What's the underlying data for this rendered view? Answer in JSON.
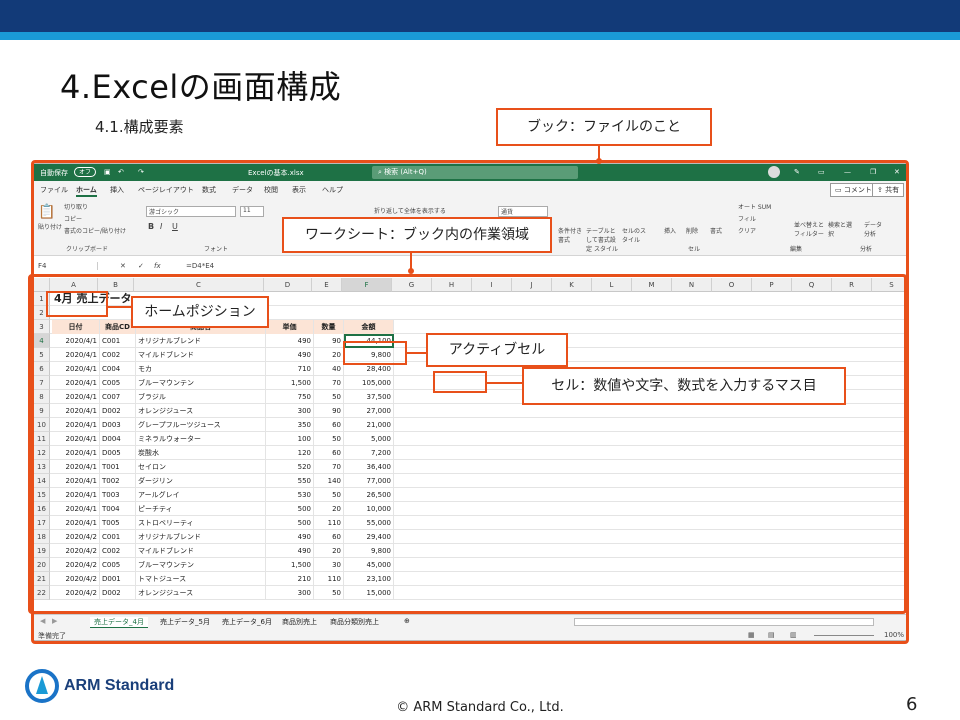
{
  "slide": {
    "title": "4.Excelの画面構成",
    "subtitle": "4.1.構成要素",
    "footer": "© ARM Standard Co., Ltd.",
    "page_number": "6",
    "logo_text": "ARM Standard"
  },
  "callouts": {
    "book": "ブック：ファイルのこと",
    "worksheet": "ワークシート：ブック内の作業領域",
    "home_position": "ホームポジション",
    "active_cell": "アクティブセル",
    "cell": "セル：数値や文字、数式を入力するマス目"
  },
  "excel": {
    "autosave": "自動保存",
    "autosave_state": "オフ",
    "filename": "Excelの基本.xlsx",
    "search_placeholder": "検索 (Alt+Q)",
    "menu": [
      "ファイル",
      "ホーム",
      "挿入",
      "ページレイアウト",
      "数式",
      "データ",
      "校閲",
      "表示",
      "ヘルプ"
    ],
    "comment_btn": "コメント",
    "share_btn": "共有",
    "ribbon": {
      "clipboard_group": "クリップボード",
      "paste": "貼り付け",
      "cut": "切り取り",
      "copy": "コピー",
      "format_painter": "書式のコピー/貼り付け",
      "font_group": "フォント",
      "font_name": "游ゴシック",
      "font_size": "11",
      "wrap": "折り返して全体を表示する",
      "number_format": "通貨",
      "conditional": "条件付き書式",
      "table": "テーブルとして書式設定",
      "cell_style": "セルのスタイル",
      "style_group": "スタイル",
      "insert": "挿入",
      "delete": "削除",
      "format": "書式",
      "cell_group": "セル",
      "autosum": "オート SUM",
      "fill": "フィル",
      "clear": "クリア",
      "sort": "並べ替えとフィルター",
      "find": "検索と選択",
      "edit_group": "編集",
      "analyze": "データ分析",
      "analyze_group": "分析"
    },
    "name_box": "F4",
    "formula": "=D4*E4",
    "columns": [
      "A",
      "B",
      "C",
      "D",
      "E",
      "F",
      "G",
      "H",
      "I",
      "J",
      "K",
      "L",
      "M",
      "N",
      "O",
      "P",
      "Q",
      "R",
      "S"
    ],
    "sheet_title": "4月 売上データ",
    "table_headers": [
      "日付",
      "商品CD",
      "商品名",
      "単価",
      "数量",
      "金額"
    ],
    "rows": [
      [
        "2020/4/1",
        "C001",
        "オリジナルブレンド",
        "490",
        "90",
        "44,100"
      ],
      [
        "2020/4/1",
        "C002",
        "マイルドブレンド",
        "490",
        "20",
        "9,800"
      ],
      [
        "2020/4/1",
        "C004",
        "モカ",
        "710",
        "40",
        "28,400"
      ],
      [
        "2020/4/1",
        "C005",
        "ブルーマウンテン",
        "1,500",
        "70",
        "105,000"
      ],
      [
        "2020/4/1",
        "C007",
        "ブラジル",
        "750",
        "50",
        "37,500"
      ],
      [
        "2020/4/1",
        "D002",
        "オレンジジュース",
        "300",
        "90",
        "27,000"
      ],
      [
        "2020/4/1",
        "D003",
        "グレープフルーツジュース",
        "350",
        "60",
        "21,000"
      ],
      [
        "2020/4/1",
        "D004",
        "ミネラルウォーター",
        "100",
        "50",
        "5,000"
      ],
      [
        "2020/4/1",
        "D005",
        "炭酸水",
        "120",
        "60",
        "7,200"
      ],
      [
        "2020/4/1",
        "T001",
        "セイロン",
        "520",
        "70",
        "36,400"
      ],
      [
        "2020/4/1",
        "T002",
        "ダージリン",
        "550",
        "140",
        "77,000"
      ],
      [
        "2020/4/1",
        "T003",
        "アールグレイ",
        "530",
        "50",
        "26,500"
      ],
      [
        "2020/4/1",
        "T004",
        "ピーチティ",
        "500",
        "20",
        "10,000"
      ],
      [
        "2020/4/1",
        "T005",
        "ストロベリーティ",
        "500",
        "110",
        "55,000"
      ],
      [
        "2020/4/2",
        "C001",
        "オリジナルブレンド",
        "490",
        "60",
        "29,400"
      ],
      [
        "2020/4/2",
        "C002",
        "マイルドブレンド",
        "490",
        "20",
        "9,800"
      ],
      [
        "2020/4/2",
        "C005",
        "ブルーマウンテン",
        "1,500",
        "30",
        "45,000"
      ],
      [
        "2020/4/2",
        "D001",
        "トマトジュース",
        "210",
        "110",
        "23,100"
      ],
      [
        "2020/4/2",
        "D002",
        "オレンジジュース",
        "300",
        "50",
        "15,000"
      ]
    ],
    "sheet_tabs": [
      "売上データ_4月",
      "売上データ_5月",
      "売上データ_6月",
      "商品別売上",
      "商品分類別売上"
    ],
    "status_ready": "準備完了",
    "zoom": "100%",
    "accent_color": "#1e7145",
    "callout_color": "#e8501a"
  }
}
